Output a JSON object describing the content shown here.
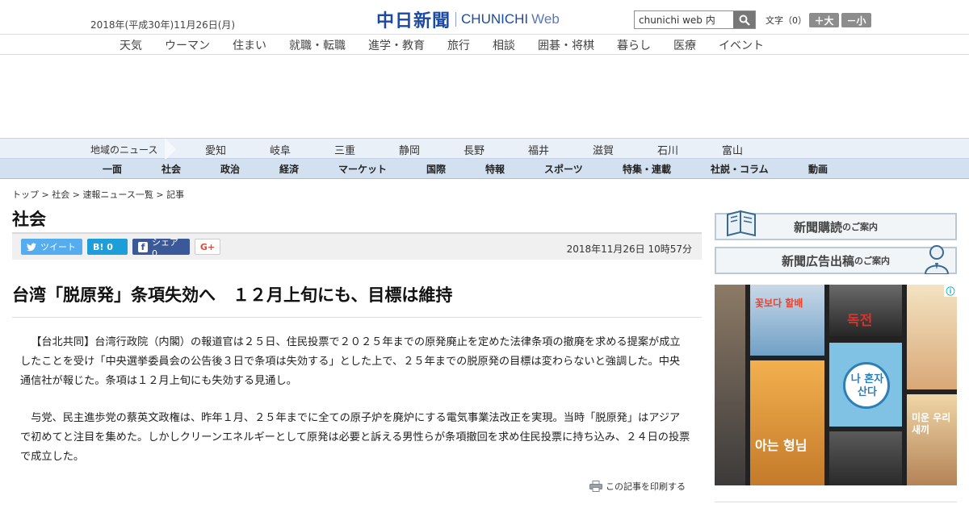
{
  "header": {
    "date": "2018年(平成30年)11月26日(月)",
    "logo_ja": "中日新聞",
    "logo_en": "CHUNICHI",
    "logo_web": "Web",
    "search_value": "chunichi web 内",
    "font_size_label": "文字（0）",
    "font_larger": "＋大",
    "font_smaller": "－小"
  },
  "category_nav": [
    "天気",
    "ウーマン",
    "住まい",
    "就職・転職",
    "進学・教育",
    "旅行",
    "相談",
    "囲碁・将棋",
    "暮らし",
    "医療",
    "イベント"
  ],
  "region_nav": {
    "label": "地域のニュース",
    "items": [
      "愛知",
      "岐阜",
      "三重",
      "静岡",
      "長野",
      "福井",
      "滋賀",
      "石川",
      "富山"
    ]
  },
  "section_nav": [
    "一面",
    "社会",
    "政治",
    "経済",
    "マーケット",
    "国際",
    "特報",
    "スポーツ",
    "特集・連載",
    "社説・コラム",
    "動画"
  ],
  "breadcrumb": {
    "items": [
      "トップ",
      "社会",
      "速報ニュース一覧",
      "記事"
    ],
    "sep": " > "
  },
  "section_title": "社会",
  "share": {
    "tweet": "ツイート",
    "hatena": "B! 0",
    "facebook": "シェア 0",
    "gplus": "G+"
  },
  "published": "2018年11月26日 10時57分",
  "article": {
    "headline": "台湾「脱原発」条項失効へ　１２月上旬にも、目標は維持",
    "paragraphs": [
      "【台北共同】台湾行政院（内閣）の報道官は２５日、住民投票で２０２５年までの原発廃止を定めた法律条項の撤廃を求める提案が成立したことを受け「中央選挙委員会の公告後３日で条項は失効する」とした上で、２５年までの脱原発の目標は変わらないと強調した。中央通信社が報じた。条項は１２月上旬にも失効する見通し。",
      "与党、民主進歩党の蔡英文政権は、昨年１月、２５年までに全ての原子炉を廃炉にする電気事業法改正を実現。当時「脱原発」はアジアで初めてと注目を集めた。しかしクリーンエネルギーとして原発は必要と訴える男性らが条項撤回を求め住民投票に持ち込み、２４日の投票で成立した。"
    ],
    "print_label": "この記事を印刷する"
  },
  "sidebar": {
    "subscribe_big": "新聞購読",
    "subscribe_small": "のご案内",
    "ad_big": "新聞広告出稿",
    "ad_small": "のご案内",
    "banner_texts": [
      "꽃보다 할배",
      "독전",
      "나 혼자 산다",
      "아는 형님",
      "미운 우리 새끼"
    ]
  },
  "colors": {
    "brand": "#1b4aa3",
    "region_bg": "#e9f0f8",
    "section_bg": "#d2e0f0",
    "twitter": "#55acee",
    "hatena": "#1d9ed9",
    "facebook": "#3b5998"
  }
}
